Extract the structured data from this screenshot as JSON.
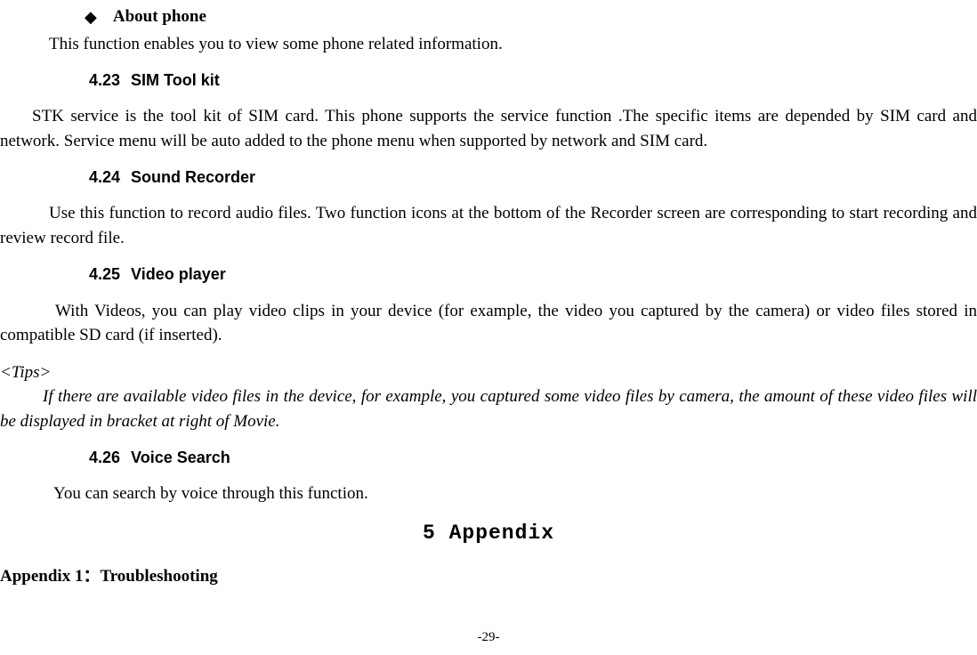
{
  "bullet": {
    "marker": "◆",
    "label": "About phone"
  },
  "aboutPhone": {
    "body": "This function enables you to view some phone related information."
  },
  "sec423": {
    "num": "4.23",
    "title": "SIM Tool kit",
    "body": "STK service is the tool kit of SIM card. This phone supports the service function .The specific items are depended by SIM card and network. Service menu will be auto added to the phone menu when supported by network and SIM card."
  },
  "sec424": {
    "num": "4.24",
    "title": "Sound Recorder",
    "body": "Use this function to record audio files. Two function icons at the bottom of the Recorder screen are corresponding to start recording and review record file."
  },
  "sec425": {
    "num": "4.25",
    "title": "Video player",
    "body": "With Videos, you can play video clips in your device (for example, the video you captured by the camera) or video files stored in compatible SD card (if inserted).",
    "tipsLabel": "<Tips>",
    "tipsBody": "If there are available video files in the device, for example, you captured some video files by camera, the amount of these video files will be displayed in bracket at right of Movie."
  },
  "sec426": {
    "num": "4.26",
    "title": "Voice Search",
    "body": "You can search by voice through this function."
  },
  "appendix": {
    "title": "5 Appendix",
    "sub": "Appendix 1：Troubleshooting"
  },
  "pageNumber": "-29-"
}
